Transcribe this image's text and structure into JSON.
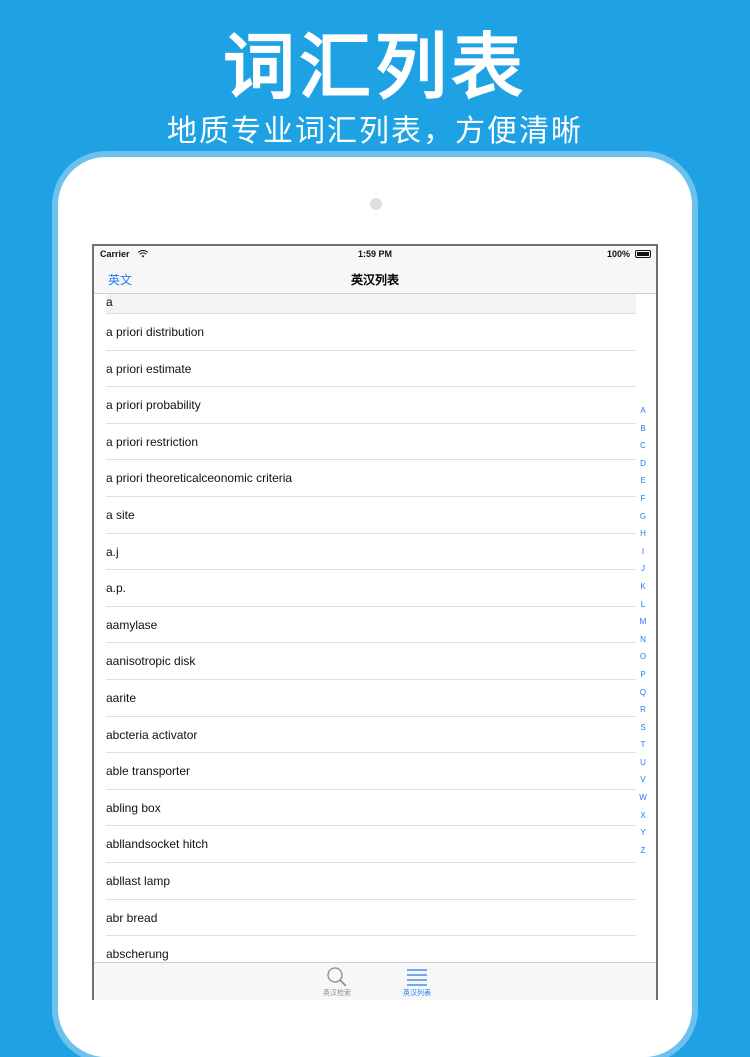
{
  "promo": {
    "title": "词汇列表",
    "subtitle": "地质专业词汇列表，方便清晰"
  },
  "status_bar": {
    "carrier": "Carrier",
    "time": "1:59 PM",
    "battery": "100%"
  },
  "nav": {
    "back_label": "英文",
    "title": "英汉列表"
  },
  "list": {
    "items": [
      "a",
      "a priori distribution",
      "a priori estimate",
      "a priori probability",
      "a priori restriction",
      "a priori theoreticalceonomic criteria",
      "a site",
      "a.j",
      "a.p.",
      "aamylase",
      "aanisotropic disk",
      "aarite",
      "abcteria activator",
      "able transporter",
      "abling box",
      "abllandsocket hitch",
      "abllast lamp",
      "abr bread",
      "abscherung"
    ]
  },
  "index": {
    "letters": [
      "A",
      "B",
      "C",
      "D",
      "E",
      "F",
      "G",
      "H",
      "I",
      "J",
      "K",
      "L",
      "M",
      "N",
      "O",
      "P",
      "Q",
      "R",
      "S",
      "T",
      "U",
      "V",
      "W",
      "X",
      "Y",
      "Z"
    ]
  },
  "tabbar": {
    "search_label": "英汉检索",
    "list_label": "英汉列表"
  },
  "colors": {
    "background": "#1ea2e4",
    "accent": "#1e7cf0"
  },
  "icons": {
    "wifi": "wifi-icon",
    "battery": "battery-icon",
    "search_tab": "magnifier-icon",
    "list_tab": "list-icon"
  }
}
